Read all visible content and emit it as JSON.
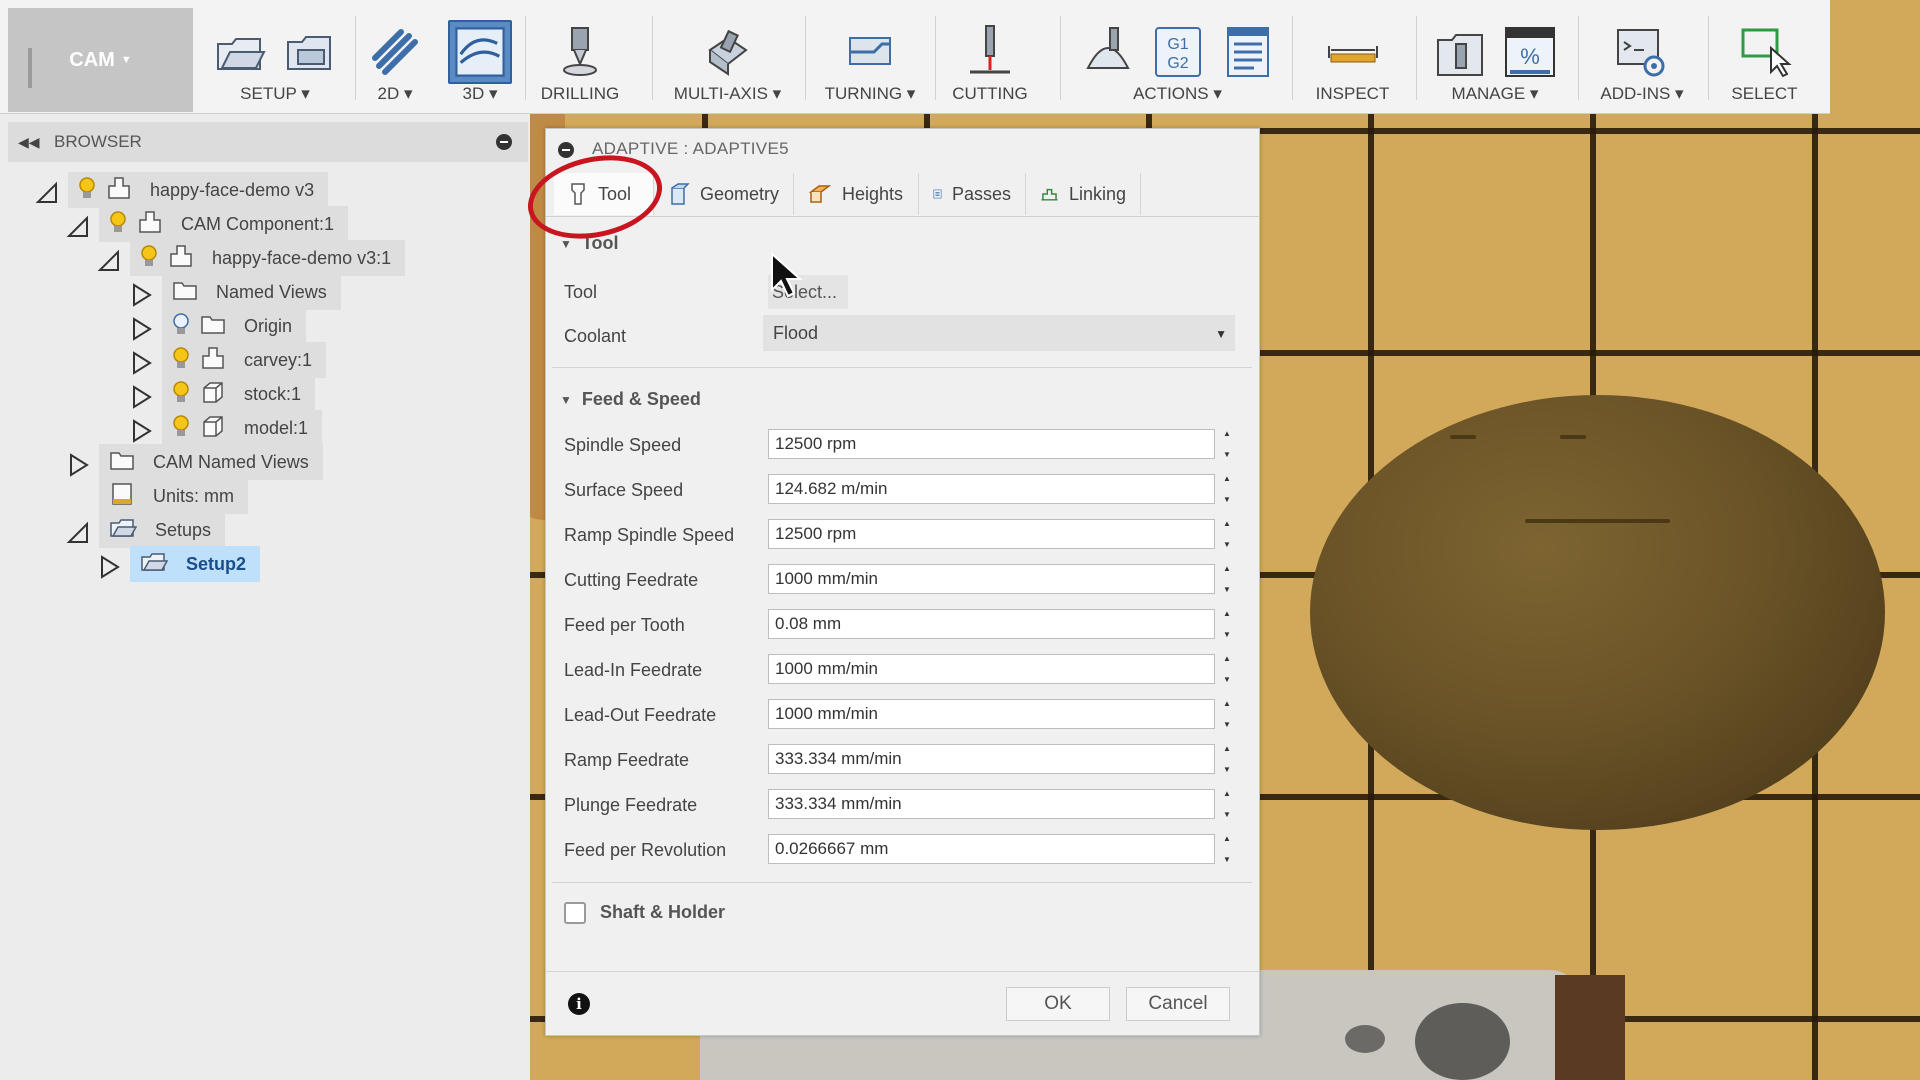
{
  "toolbar": {
    "workspace": "CAM",
    "groups": [
      {
        "label": "SETUP ▾"
      },
      {
        "label": "2D ▾"
      },
      {
        "label": "3D ▾"
      },
      {
        "label": "DRILLING"
      },
      {
        "label": "MULTI-AXIS ▾"
      },
      {
        "label": "TURNING ▾"
      },
      {
        "label": "CUTTING"
      },
      {
        "label": "ACTIONS ▾"
      },
      {
        "label": "INSPECT"
      },
      {
        "label": "MANAGE ▾"
      },
      {
        "label": "ADD-INS ▾"
      },
      {
        "label": "SELECT"
      }
    ],
    "g1g2_line1": "G1",
    "g1g2_line2": "G2",
    "percent_symbol": "%",
    "active_group": "3D"
  },
  "browser": {
    "title": "BROWSER",
    "items": [
      {
        "label": "happy-face-demo v3"
      },
      {
        "label": "CAM Component:1"
      },
      {
        "label": "happy-face-demo v3:1"
      },
      {
        "label": "Named Views"
      },
      {
        "label": "Origin"
      },
      {
        "label": "carvey:1"
      },
      {
        "label": "stock:1"
      },
      {
        "label": "model:1"
      },
      {
        "label": "CAM Named Views"
      },
      {
        "label": "Units: mm"
      },
      {
        "label": "Setups"
      },
      {
        "label": "Setup2"
      }
    ]
  },
  "dialog": {
    "title": "ADAPTIVE : ADAPTIVE5",
    "tabs": [
      {
        "label": "Tool"
      },
      {
        "label": "Geometry"
      },
      {
        "label": "Heights"
      },
      {
        "label": "Passes"
      },
      {
        "label": "Linking"
      }
    ],
    "active_tab": "Tool",
    "tool_section": {
      "heading": "Tool",
      "tool_label": "Tool",
      "tool_button": "Select...",
      "coolant_label": "Coolant",
      "coolant_value": "Flood"
    },
    "feed_section": {
      "heading": "Feed & Speed",
      "fields": [
        {
          "label": "Spindle Speed",
          "value": "12500 rpm"
        },
        {
          "label": "Surface Speed",
          "value": "124.682 m/min"
        },
        {
          "label": "Ramp Spindle Speed",
          "value": "12500 rpm"
        },
        {
          "label": "Cutting Feedrate",
          "value": "1000 mm/min"
        },
        {
          "label": "Feed per Tooth",
          "value": "0.08 mm"
        },
        {
          "label": "Lead-In Feedrate",
          "value": "1000 mm/min"
        },
        {
          "label": "Lead-Out Feedrate",
          "value": "1000 mm/min"
        },
        {
          "label": "Ramp Feedrate",
          "value": "333.334 mm/min"
        },
        {
          "label": "Plunge Feedrate",
          "value": "333.334 mm/min"
        },
        {
          "label": "Feed per Revolution",
          "value": "0.0266667 mm"
        }
      ]
    },
    "shaft_section": {
      "heading": "Shaft & Holder",
      "checked": false
    },
    "ok_label": "OK",
    "cancel_label": "Cancel"
  },
  "colors": {
    "annotation_circle": "#c8151f",
    "selected_node": "#bfe0fb",
    "active_tool_button": "#5b8bc4"
  }
}
